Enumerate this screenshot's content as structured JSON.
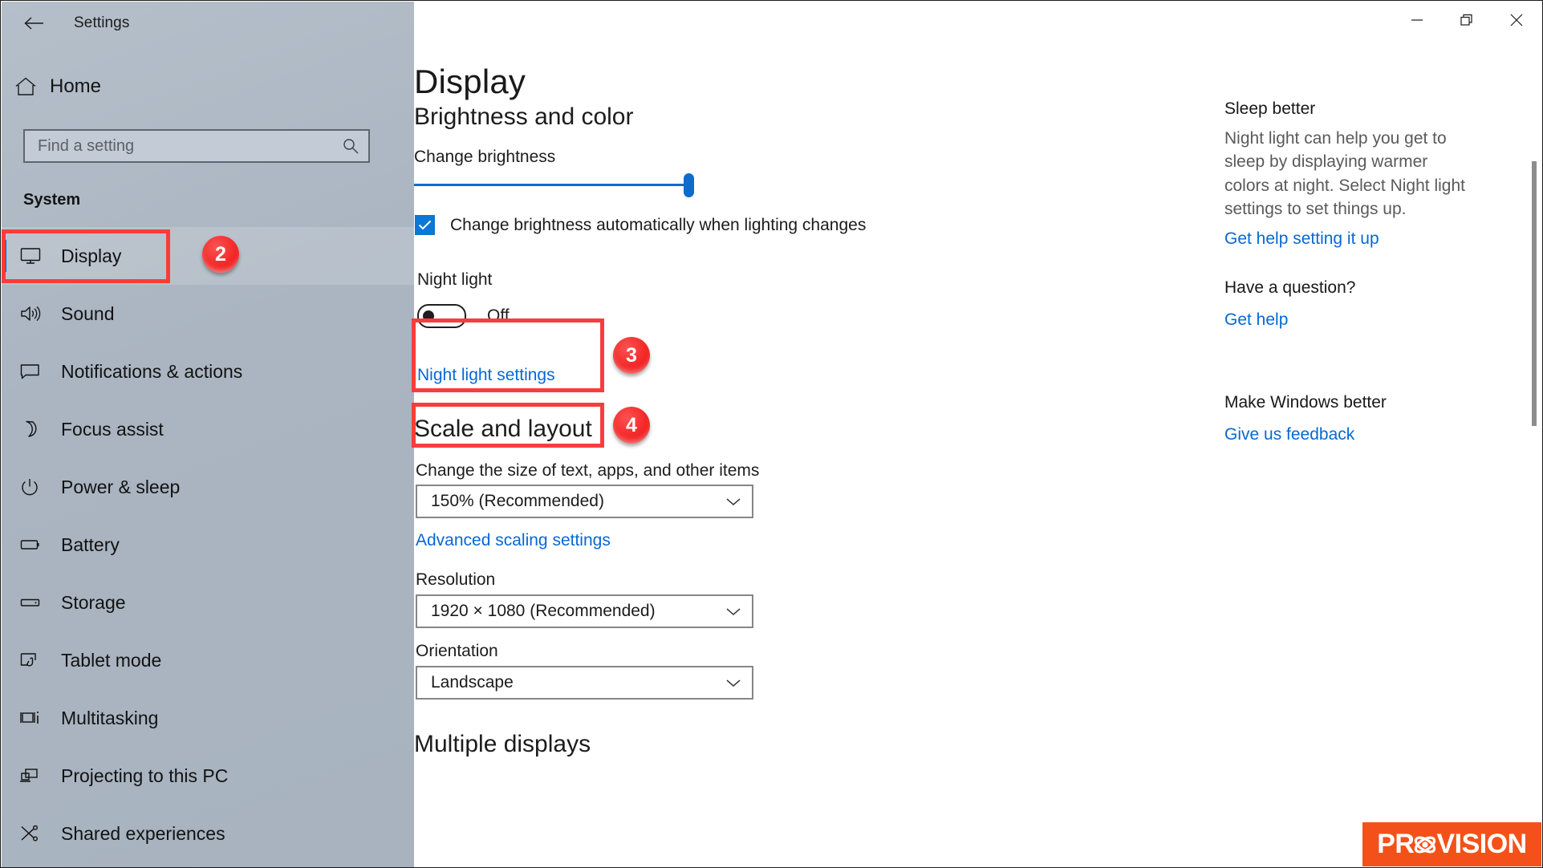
{
  "window": {
    "title": "Settings",
    "back_icon": "back-arrow-icon",
    "minimize_label": "—",
    "restore_label": "❐",
    "close_label": "✕"
  },
  "sidebar": {
    "home_label": "Home",
    "home_icon": "home-icon",
    "search": {
      "placeholder": "Find a setting",
      "value": "",
      "icon": "search-icon"
    },
    "section_label": "System",
    "items": [
      {
        "label": "Display",
        "icon": "monitor-icon",
        "selected": true
      },
      {
        "label": "Sound",
        "icon": "speaker-icon",
        "selected": false
      },
      {
        "label": "Notifications & actions",
        "icon": "chat-icon",
        "selected": false
      },
      {
        "label": "Focus assist",
        "icon": "moon-icon",
        "selected": false
      },
      {
        "label": "Power & sleep",
        "icon": "power-icon",
        "selected": false
      },
      {
        "label": "Battery",
        "icon": "battery-icon",
        "selected": false
      },
      {
        "label": "Storage",
        "icon": "drive-icon",
        "selected": false
      },
      {
        "label": "Tablet mode",
        "icon": "tablet-icon",
        "selected": false
      },
      {
        "label": "Multitasking",
        "icon": "multitask-icon",
        "selected": false
      },
      {
        "label": "Projecting to this PC",
        "icon": "project-icon",
        "selected": false
      },
      {
        "label": "Shared experiences",
        "icon": "share-icon",
        "selected": false
      }
    ]
  },
  "main": {
    "page_title": "Display",
    "brightness_section": {
      "heading": "Brightness and color",
      "slider_label": "Change brightness",
      "slider_value": 96,
      "auto_brightness_label": "Change brightness automatically when lighting changes",
      "auto_brightness_checked": true
    },
    "night_light": {
      "label": "Night light",
      "state": "Off",
      "toggle_on": false,
      "settings_link": "Night light settings"
    },
    "scale_section": {
      "heading": "Scale and layout",
      "scale_label": "Change the size of text, apps, and other items",
      "scale_value": "150% (Recommended)",
      "advanced_link": "Advanced scaling settings",
      "resolution_label": "Resolution",
      "resolution_value": "1920 × 1080 (Recommended)",
      "orientation_label": "Orientation",
      "orientation_value": "Landscape"
    },
    "multiple_displays_heading": "Multiple displays"
  },
  "right_panel": {
    "blocks": [
      {
        "heading": "Sleep better",
        "body": "Night light can help you get to sleep by displaying warmer colors at night. Select Night light settings to set things up.",
        "link": "Get help setting it up"
      },
      {
        "heading": "Have a question?",
        "body": "",
        "link": "Get help"
      },
      {
        "heading": "Make Windows better",
        "body": "",
        "link": "Give us feedback"
      }
    ]
  },
  "annotations": {
    "badges": [
      {
        "number": "2",
        "target": "sidebar-item-display"
      },
      {
        "number": "3",
        "target": "night-light-toggle"
      },
      {
        "number": "4",
        "target": "night-light-settings-link"
      }
    ],
    "highlight_color": "#fa3c3c"
  },
  "watermark": {
    "brand_pre": "PR",
    "brand_post": "VISION",
    "background_color": "#f4511a",
    "text_color": "#ffffff"
  }
}
